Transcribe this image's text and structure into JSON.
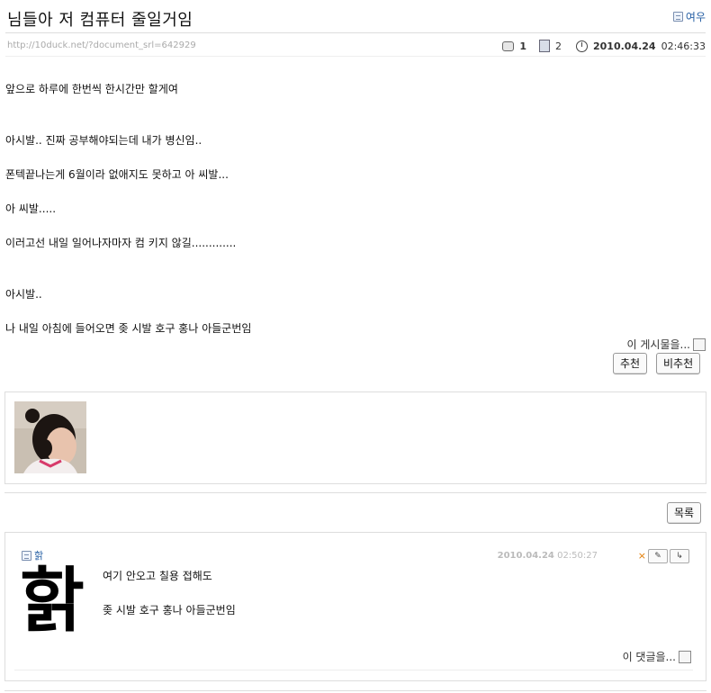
{
  "post": {
    "title": "님들아 저 컴퓨터 줄일거임",
    "author": "여우",
    "url": "http://10duck.net/?document_srl=642929",
    "comment_count": "1",
    "trackback_count": "2",
    "date": "2010.04.24",
    "time": "02:46:33",
    "lines": [
      "앞으로 하루에 한번씩 한시간만 할게여",
      "아시발.. 진짜 공부해야되는데 내가 병신임..",
      "폰텍끝나는게 6월이라 없애지도 못하고 아 씨발...",
      "아 씨발.....",
      "이러고선 내일 일어나자마자 컴 키지 않길.............",
      "아시발..",
      "나 내일 아침에 들어오면 좆 시발 호구 홍나 아들군번임"
    ],
    "report_label": "이 게시물을...",
    "recommend_label": "추천",
    "unrecommend_label": "비추천",
    "list_label": "목록"
  },
  "comment": {
    "author": "핡",
    "signature": "핡",
    "date": "2010.04.24",
    "time": "02:50:27",
    "delete_mark": "×",
    "lines": [
      "여기 안오고 칠용 접해도",
      "좆 시발 호구 홍나 아들군번임"
    ],
    "report_label": "이 댓글을..."
  },
  "colors": {
    "link": "#2a62a6",
    "delete": "#e27a00",
    "divider": "#dddddd"
  }
}
